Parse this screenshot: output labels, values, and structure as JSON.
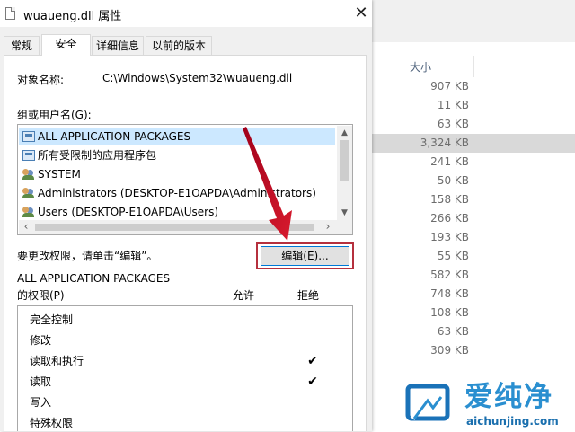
{
  "dialog": {
    "title": "wuaueng.dll 属性",
    "close_glyph": "✕",
    "tabs": [
      "常规",
      "安全",
      "详细信息",
      "以前的版本"
    ],
    "active_tab": "安全",
    "object_name_label": "对象名称:",
    "object_name_value": "C:\\Windows\\System32\\wuaueng.dll",
    "groups_label": "组或用户名(G):",
    "groups": [
      {
        "name": "ALL APPLICATION PACKAGES",
        "icon": "package-icon",
        "selected": true
      },
      {
        "name": "所有受限制的应用程序包",
        "icon": "package-icon",
        "selected": false
      },
      {
        "name": "SYSTEM",
        "icon": "users-icon",
        "selected": false
      },
      {
        "name": "Administrators (DESKTOP-E1OAPDA\\Administrators)",
        "icon": "users-icon",
        "selected": false
      },
      {
        "name": "Users (DESKTOP-E1OAPDA\\Users)",
        "icon": "users-icon",
        "selected": false
      }
    ],
    "change_permission_hint": "要更改权限，请单击“编辑”。",
    "edit_button": "编辑(E)...",
    "permissions_for": "ALL APPLICATION PACKAGES",
    "permissions_label": "的权限(P)",
    "allow_header": "允许",
    "deny_header": "拒绝",
    "permissions": [
      {
        "name": "完全控制",
        "allow": false,
        "deny": false
      },
      {
        "name": "修改",
        "allow": false,
        "deny": false
      },
      {
        "name": "读取和执行",
        "allow": true,
        "deny": false
      },
      {
        "name": "读取",
        "allow": true,
        "deny": false
      },
      {
        "name": "写入",
        "allow": false,
        "deny": false
      },
      {
        "name": "特殊权限",
        "allow": false,
        "deny": false
      }
    ],
    "check_glyph": "✔"
  },
  "explorer": {
    "size_header": "大小",
    "sizes": [
      "907 KB",
      "11 KB",
      "63 KB",
      "3,324 KB",
      "241 KB",
      "50 KB",
      "158 KB",
      "266 KB",
      "193 KB",
      "55 KB",
      "582 KB",
      "748 KB",
      "108 KB",
      "63 KB",
      "309 KB"
    ],
    "selected_index": 3
  },
  "watermark": {
    "chinese": "爱纯净",
    "url": "aichunjing.com"
  },
  "colors": {
    "highlight_frame": "#b5303e",
    "arrow": "#c8102e",
    "selection": "#cce8ff",
    "watermark": "#2a8fd0"
  }
}
